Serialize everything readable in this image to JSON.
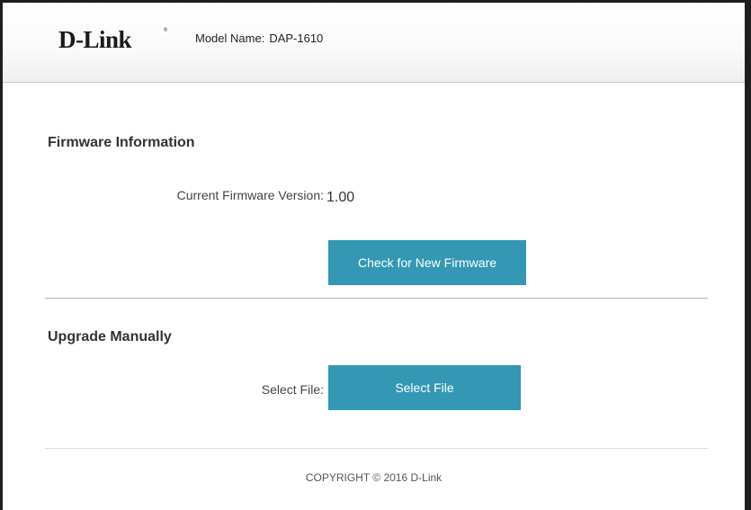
{
  "header": {
    "logo": "D-Link",
    "logo_registered": "®",
    "model_label": "Model Name:",
    "model_value": "DAP-1610"
  },
  "firmware_info": {
    "title": "Firmware Information",
    "current_version_label": "Current Firmware Version:",
    "current_version_value": "1.00",
    "check_button": "Check for New Firmware"
  },
  "upgrade_manually": {
    "title": "Upgrade Manually",
    "select_file_label": "Select File:",
    "select_file_button": "Select File"
  },
  "footer": {
    "copyright": "COPYRIGHT © 2016 D-Link"
  },
  "colors": {
    "button": "#3497b4",
    "divider": "#b4b4b4"
  }
}
